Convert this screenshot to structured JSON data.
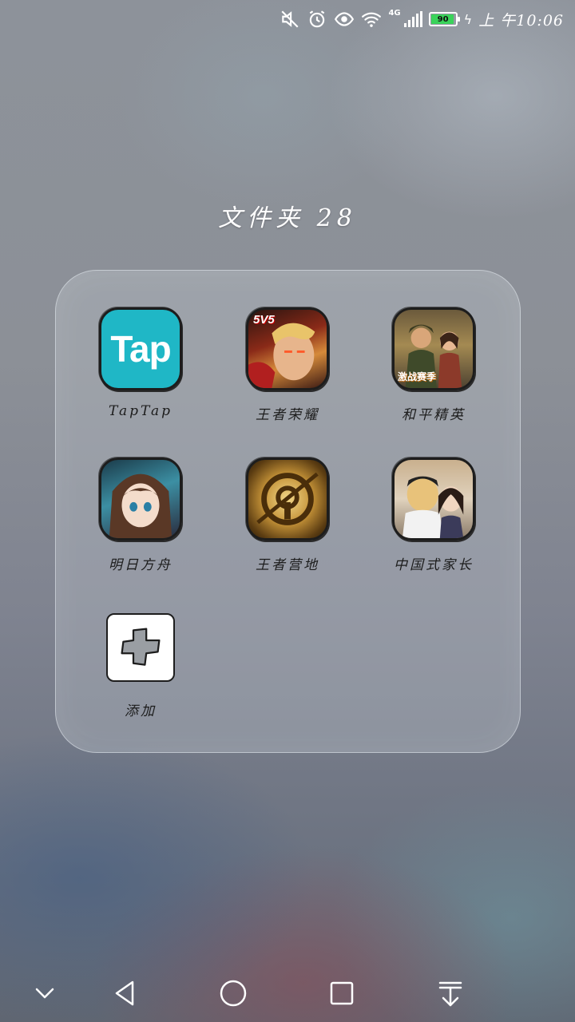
{
  "status_bar": {
    "network_type": "4G",
    "battery_level": "90",
    "time": "上 午10:06",
    "icons": [
      "mute-icon",
      "alarm-icon",
      "eye-comfort-icon",
      "wifi-icon",
      "signal-icon",
      "battery-icon",
      "charging-icon"
    ]
  },
  "folder": {
    "title": "文件夹 28",
    "apps": [
      {
        "label": "TapTap",
        "icon_text": "Tap"
      },
      {
        "label": "王者荣耀",
        "icon_text": "5V5"
      },
      {
        "label": "和平精英",
        "icon_text": "激战赛季"
      },
      {
        "label": "明日方舟"
      },
      {
        "label": "王者营地"
      },
      {
        "label": "中国式家长"
      }
    ],
    "add_label": "添加"
  },
  "nav_bar": {
    "buttons": [
      "collapse-icon",
      "back-icon",
      "home-icon",
      "recents-icon",
      "notification-pulldown-icon"
    ]
  }
}
